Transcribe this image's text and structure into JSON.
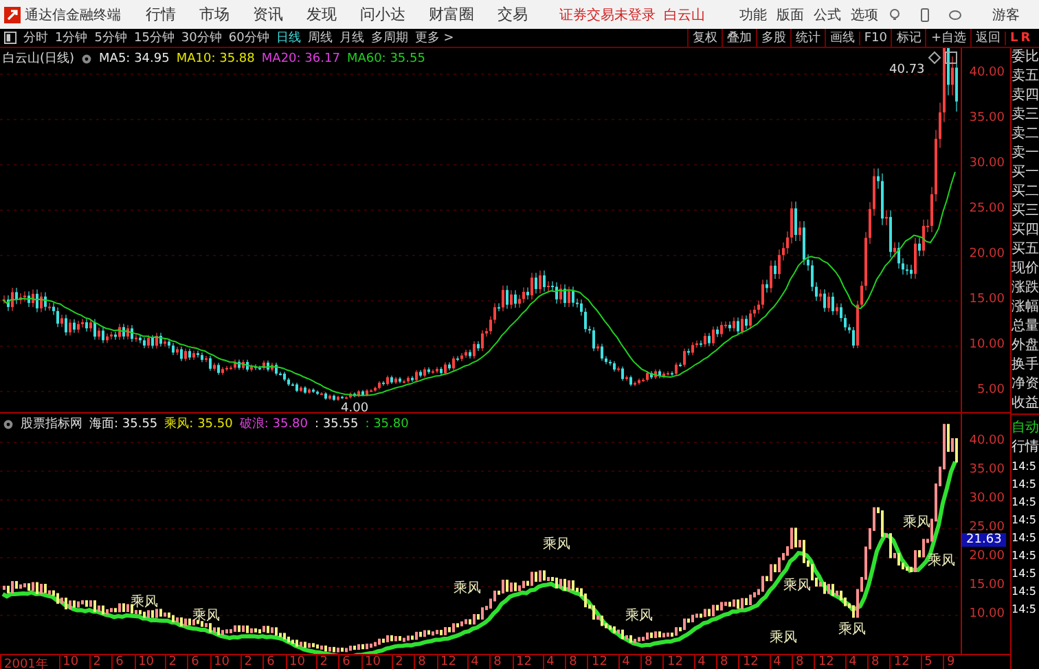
{
  "menu_bar": {
    "app_name": "通达信金融终端",
    "items": [
      "行情",
      "市场",
      "资讯",
      "发现",
      "问小达",
      "财富圈",
      "交易"
    ],
    "login_status": "证券交易未登录",
    "stock_name": "白云山",
    "right_items": [
      "功能",
      "版面",
      "公式",
      "选项"
    ],
    "user": "游客"
  },
  "period_bar": {
    "periods": [
      {
        "label": "分时",
        "selected": false
      },
      {
        "label": "1分钟",
        "selected": false
      },
      {
        "label": "5分钟",
        "selected": false
      },
      {
        "label": "15分钟",
        "selected": false
      },
      {
        "label": "30分钟",
        "selected": false
      },
      {
        "label": "60分钟",
        "selected": false
      },
      {
        "label": "日线",
        "selected": true
      },
      {
        "label": "周线",
        "selected": false
      },
      {
        "label": "月线",
        "selected": false
      },
      {
        "label": "多周期",
        "selected": false
      },
      {
        "label": "更多 >",
        "selected": false
      }
    ],
    "tools": [
      "复权",
      "叠加",
      "多股",
      "统计",
      "画线",
      "F10",
      "标记",
      "+自选",
      "返回"
    ],
    "panel_tabs": [
      "L",
      "R"
    ]
  },
  "main_chart": {
    "legend": {
      "title": "白云山(日线)",
      "indicators": [
        {
          "label": "MA5: 34.95",
          "color": "#e8e8e8"
        },
        {
          "label": "MA10: 35.88",
          "color": "#e6e600"
        },
        {
          "label": "MA20: 36.17",
          "color": "#e040e0"
        },
        {
          "label": "MA60: 35.55",
          "color": "#20d020"
        }
      ]
    },
    "y_axis_labels": [
      "40.00",
      "35.00",
      "30.00",
      "25.00",
      "20.00",
      "15.00",
      "10.00",
      "5.00"
    ],
    "high_label": "40.73",
    "low_label": "4.00"
  },
  "indicator_chart": {
    "legend": {
      "title": "股票指标网",
      "indicators": [
        {
          "label": "海面: 35.55",
          "color": "#e8e8e8"
        },
        {
          "label": "乘风: 35.50",
          "color": "#e6e600"
        },
        {
          "label": "破浪: 35.80",
          "color": "#e040e0"
        },
        {
          "label": ": 35.55",
          "color": "#e8e8e8"
        },
        {
          "label": ": 35.80",
          "color": "#20d020"
        }
      ]
    },
    "y_axis_labels": [
      "40.00",
      "35.00",
      "30.00",
      "25.00",
      "20.00",
      "15.00",
      "10.00"
    ],
    "current_price": "21.63",
    "signals": [
      "乘风",
      "乘风",
      "乘风",
      "乘风",
      "乘风",
      "乘风",
      "乘风",
      "乘风",
      "乘风",
      "乘风"
    ]
  },
  "x_axis_labels": [
    "2001年",
    "10",
    "2",
    "6",
    "10",
    "2",
    "6",
    "10",
    "2",
    "6",
    "10",
    "2",
    "6",
    "10",
    "2",
    "8",
    "12",
    "4",
    "8",
    "12",
    "4",
    "8",
    "12",
    "4",
    "8",
    "12",
    "4",
    "8",
    "12",
    "4",
    "8",
    "12",
    "4",
    "8",
    "12",
    "5",
    "9"
  ],
  "quote_panel": {
    "labels": [
      "委比",
      "卖五",
      "卖四",
      "卖三",
      "卖二",
      "卖一",
      "买一",
      "买二",
      "买三",
      "买四",
      "买五",
      "现价",
      "涨跌",
      "涨幅",
      "总量",
      "外盘",
      "换手",
      "净资",
      "收益"
    ],
    "lower_labels": [
      {
        "label": "自动",
        "color": "#20d020"
      },
      {
        "label": "行情",
        "color": "#e8e8e8"
      }
    ],
    "times": [
      "14:5",
      "14:5",
      "14:5",
      "14:5",
      "14:5",
      "14:5",
      "14:5",
      "14:5",
      "14:5"
    ]
  }
}
